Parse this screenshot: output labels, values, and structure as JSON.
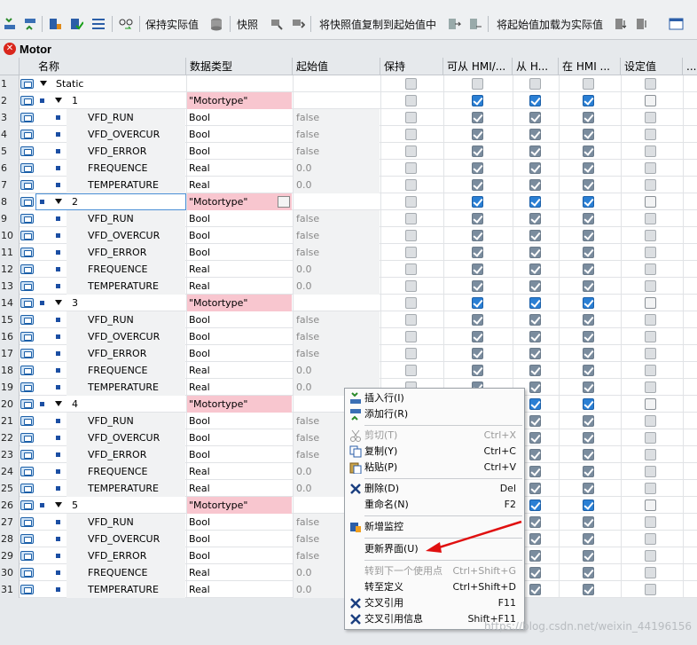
{
  "toolbar": {
    "keep_actual": "保持实际值",
    "snapshot": "快照",
    "copy_snapshot": "将快照值复制到起始值中",
    "load_start": "将起始值加载为实际值"
  },
  "title": "Motor",
  "columns": [
    "名称",
    "数据类型",
    "起始值",
    "保持",
    "可从 HMI/...",
    "从 H...",
    "在 HMI ...",
    "设定值",
    "..."
  ],
  "rows": [
    {
      "n": "1",
      "name": "Static",
      "type": "",
      "start": "",
      "kind": "section"
    },
    {
      "n": "2",
      "name": "1",
      "type": "\"Motortype\"",
      "start": "",
      "kind": "struct"
    },
    {
      "n": "3",
      "name": "VFD_RUN",
      "type": "Bool",
      "start": "false",
      "kind": "member"
    },
    {
      "n": "4",
      "name": "VFD_OVERCUR",
      "type": "Bool",
      "start": "false",
      "kind": "member"
    },
    {
      "n": "5",
      "name": "VFD_ERROR",
      "type": "Bool",
      "start": "false",
      "kind": "member"
    },
    {
      "n": "6",
      "name": "FREQUENCE",
      "type": "Real",
      "start": "0.0",
      "kind": "member"
    },
    {
      "n": "7",
      "name": "TEMPERATURE",
      "type": "Real",
      "start": "0.0",
      "kind": "member"
    },
    {
      "n": "8",
      "name": "2",
      "type": "\"Motortype\"",
      "start": "",
      "kind": "struct"
    },
    {
      "n": "9",
      "name": "VFD_RUN",
      "type": "Bool",
      "start": "false",
      "kind": "member"
    },
    {
      "n": "10",
      "name": "VFD_OVERCUR",
      "type": "Bool",
      "start": "false",
      "kind": "member"
    },
    {
      "n": "11",
      "name": "VFD_ERROR",
      "type": "Bool",
      "start": "false",
      "kind": "member"
    },
    {
      "n": "12",
      "name": "FREQUENCE",
      "type": "Real",
      "start": "0.0",
      "kind": "member"
    },
    {
      "n": "13",
      "name": "TEMPERATURE",
      "type": "Real",
      "start": "0.0",
      "kind": "member"
    },
    {
      "n": "14",
      "name": "3",
      "type": "\"Motortype\"",
      "start": "",
      "kind": "struct"
    },
    {
      "n": "15",
      "name": "VFD_RUN",
      "type": "Bool",
      "start": "false",
      "kind": "member"
    },
    {
      "n": "16",
      "name": "VFD_OVERCUR",
      "type": "Bool",
      "start": "false",
      "kind": "member"
    },
    {
      "n": "17",
      "name": "VFD_ERROR",
      "type": "Bool",
      "start": "false",
      "kind": "member"
    },
    {
      "n": "18",
      "name": "FREQUENCE",
      "type": "Real",
      "start": "0.0",
      "kind": "member"
    },
    {
      "n": "19",
      "name": "TEMPERATURE",
      "type": "Real",
      "start": "0.0",
      "kind": "member"
    },
    {
      "n": "20",
      "name": "4",
      "type": "\"Motortype\"",
      "start": "",
      "kind": "struct"
    },
    {
      "n": "21",
      "name": "VFD_RUN",
      "type": "Bool",
      "start": "false",
      "kind": "member"
    },
    {
      "n": "22",
      "name": "VFD_OVERCUR",
      "type": "Bool",
      "start": "false",
      "kind": "member"
    },
    {
      "n": "23",
      "name": "VFD_ERROR",
      "type": "Bool",
      "start": "false",
      "kind": "member"
    },
    {
      "n": "24",
      "name": "FREQUENCE",
      "type": "Real",
      "start": "0.0",
      "kind": "member"
    },
    {
      "n": "25",
      "name": "TEMPERATURE",
      "type": "Real",
      "start": "0.0",
      "kind": "member"
    },
    {
      "n": "26",
      "name": "5",
      "type": "\"Motortype\"",
      "start": "",
      "kind": "struct"
    },
    {
      "n": "27",
      "name": "VFD_RUN",
      "type": "Bool",
      "start": "false",
      "kind": "member"
    },
    {
      "n": "28",
      "name": "VFD_OVERCUR",
      "type": "Bool",
      "start": "false",
      "kind": "member"
    },
    {
      "n": "29",
      "name": "VFD_ERROR",
      "type": "Bool",
      "start": "false",
      "kind": "member"
    },
    {
      "n": "30",
      "name": "FREQUENCE",
      "type": "Real",
      "start": "0.0",
      "kind": "member"
    },
    {
      "n": "31",
      "name": "TEMPERATURE",
      "type": "Real",
      "start": "0.0",
      "kind": "member"
    }
  ],
  "menu": {
    "insert_row": "插入行(I)",
    "add_row": "添加行(R)",
    "cut": "剪切(T)",
    "cut_sc": "Ctrl+X",
    "copy": "复制(Y)",
    "copy_sc": "Ctrl+C",
    "paste": "粘贴(P)",
    "paste_sc": "Ctrl+V",
    "delete": "删除(D)",
    "delete_sc": "Del",
    "rename": "重命名(N)",
    "rename_sc": "F2",
    "new_watch": "新增监控",
    "update_ui": "更新界面(U)",
    "next_use": "转到下一个使用点",
    "next_use_sc": "Ctrl+Shift+G",
    "goto_def": "转至定义",
    "goto_def_sc": "Ctrl+Shift+D",
    "xref": "交叉引用",
    "xref_sc": "F11",
    "xref_info": "交叉引用信息",
    "xref_info_sc": "Shift+F11"
  },
  "watermark": "https://blog.csdn.net/weixin_44196156"
}
